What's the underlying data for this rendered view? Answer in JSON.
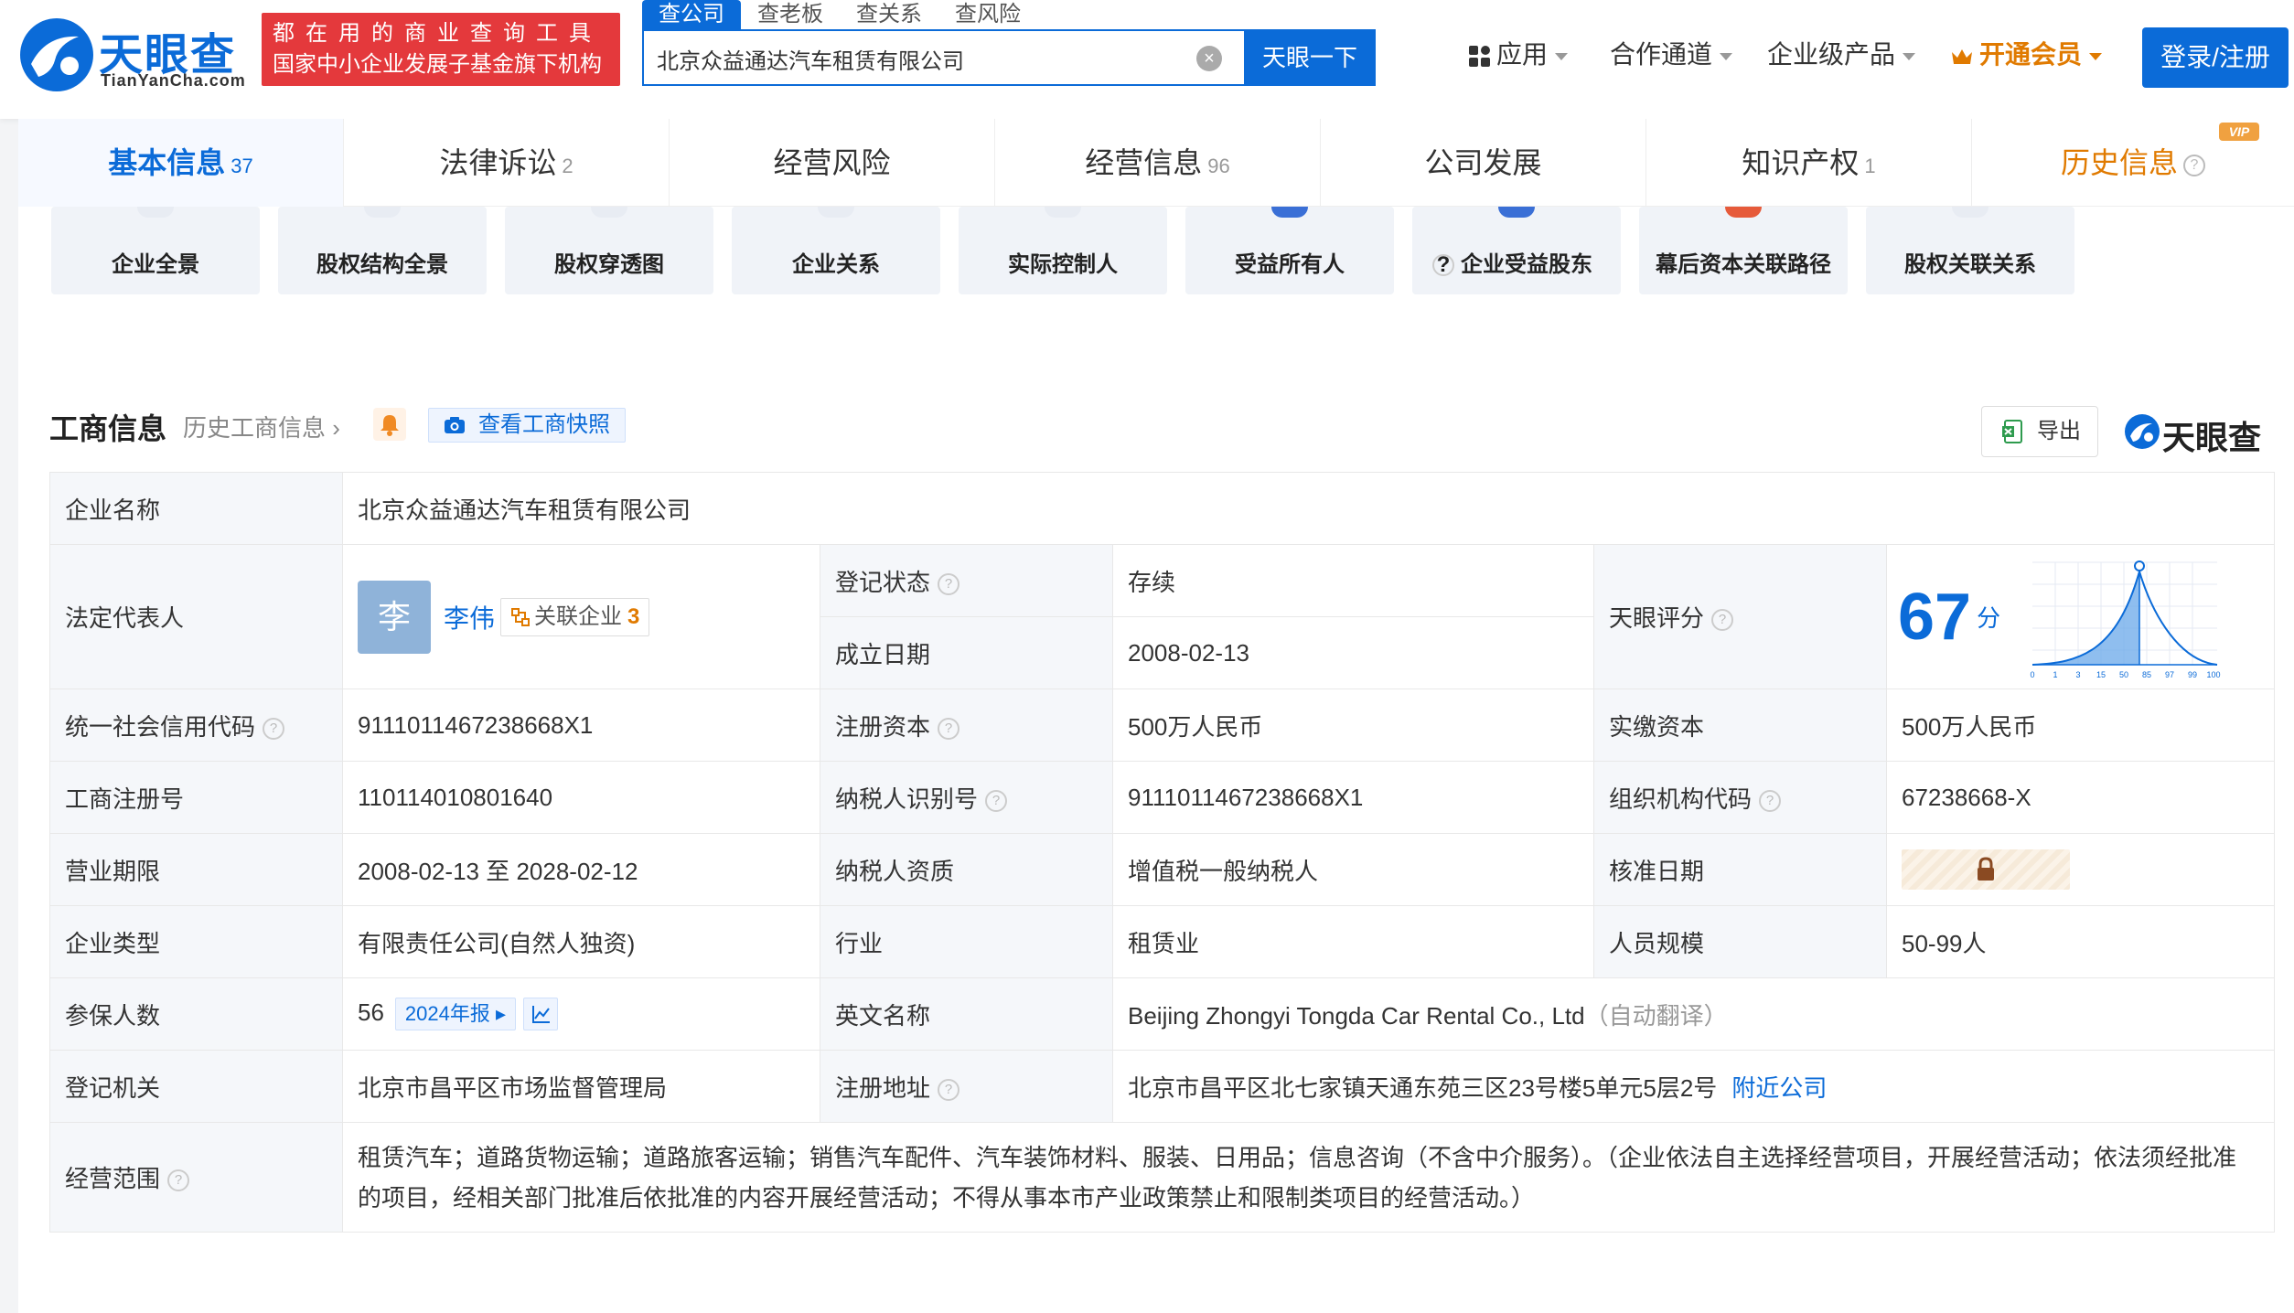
{
  "header": {
    "logo_cn": "天眼查",
    "logo_en": "TianYanCha.com",
    "slogan_line1": "都在用的商业查询工具",
    "slogan_line2": "国家中小企业发展子基金旗下机构",
    "search_tabs": [
      "查公司",
      "查老板",
      "查关系",
      "查风险"
    ],
    "search_value": "北京众益通达汽车租赁有限公司",
    "search_button": "天眼一下",
    "nav": {
      "apps": "应用",
      "channels": "合作通道",
      "enterprise": "企业级产品",
      "vip": "开通会员",
      "login": "登录/注册"
    }
  },
  "tabs": [
    {
      "label": "基本信息",
      "count": "37"
    },
    {
      "label": "法律诉讼",
      "count": "2"
    },
    {
      "label": "经营风险",
      "count": ""
    },
    {
      "label": "经营信息",
      "count": "96"
    },
    {
      "label": "公司发展",
      "count": ""
    },
    {
      "label": "知识产权",
      "count": "1"
    },
    {
      "label": "历史信息",
      "count": "",
      "badge": "VIP"
    }
  ],
  "tool_cards": [
    "企业全景",
    "股权结构全景",
    "股权穿透图",
    "企业关系",
    "实际控制人",
    "受益所有人",
    "企业受益股东",
    "幕后资本关联路径",
    "股权关联关系"
  ],
  "section": {
    "title": "工商信息",
    "history_link": "历史工商信息",
    "snapshot_button": "查看工商快照",
    "export_button": "导出",
    "brand": "天眼查"
  },
  "info": {
    "company_name_label": "企业名称",
    "company_name": "北京众益通达汽车租赁有限公司",
    "legal_rep_label": "法定代表人",
    "legal_rep_avatar": "李",
    "legal_rep_name": "李伟",
    "related_label": "关联企业",
    "related_count": "3",
    "reg_status_label": "登记状态",
    "reg_status": "存续",
    "found_date_label": "成立日期",
    "found_date": "2008-02-13",
    "score_label": "天眼评分",
    "score": "67",
    "score_unit": "分",
    "score_axis": [
      "0",
      "1",
      "3",
      "15",
      "50",
      "85",
      "97",
      "99",
      "100"
    ],
    "credit_code_label": "统一社会信用代码",
    "credit_code": "9111011467238668X1",
    "reg_capital_label": "注册资本",
    "reg_capital": "500万人民币",
    "paid_capital_label": "实缴资本",
    "paid_capital": "500万人民币",
    "reg_no_label": "工商注册号",
    "reg_no": "110114010801640",
    "taxpayer_id_label": "纳税人识别号",
    "taxpayer_id": "9111011467238668X1",
    "org_code_label": "组织机构代码",
    "org_code": "67238668-X",
    "term_label": "营业期限",
    "term": "2008-02-13 至 2028-02-12",
    "taxpayer_type_label": "纳税人资质",
    "taxpayer_type": "增值税一般纳税人",
    "approve_date_label": "核准日期",
    "company_type_label": "企业类型",
    "company_type": "有限责任公司(自然人独资)",
    "industry_label": "行业",
    "industry": "租赁业",
    "staff_size_label": "人员规模",
    "staff_size": "50-99人",
    "insured_label": "参保人数",
    "insured": "56",
    "annual_report": "2024年报",
    "english_name_label": "英文名称",
    "english_name": "Beijing Zhongyi Tongda Car Rental Co., Ltd",
    "auto_translate": "（自动翻译）",
    "authority_label": "登记机关",
    "authority": "北京市昌平区市场监督管理局",
    "address_label": "注册地址",
    "address": "北京市昌平区北七家镇天通东苑三区23号楼5单元5层2号",
    "nearby": "附近公司",
    "scope_label": "经营范围",
    "scope": "租赁汽车；道路货物运输；道路旅客运输；销售汽车配件、汽车装饰材料、服装、日用品；信息咨询（不含中介服务）。（企业依法自主选择经营项目，开展经营活动；依法须经批准的项目，经相关部门批准后依批准的内容开展经营活动；不得从事本市产业政策禁止和限制类项目的经营活动。）"
  },
  "colors": {
    "brand_blue": "#0b6bd8",
    "slogan_red": "#e4393c",
    "status_green": "#2ea844",
    "vip_orange": "#e07a00"
  }
}
